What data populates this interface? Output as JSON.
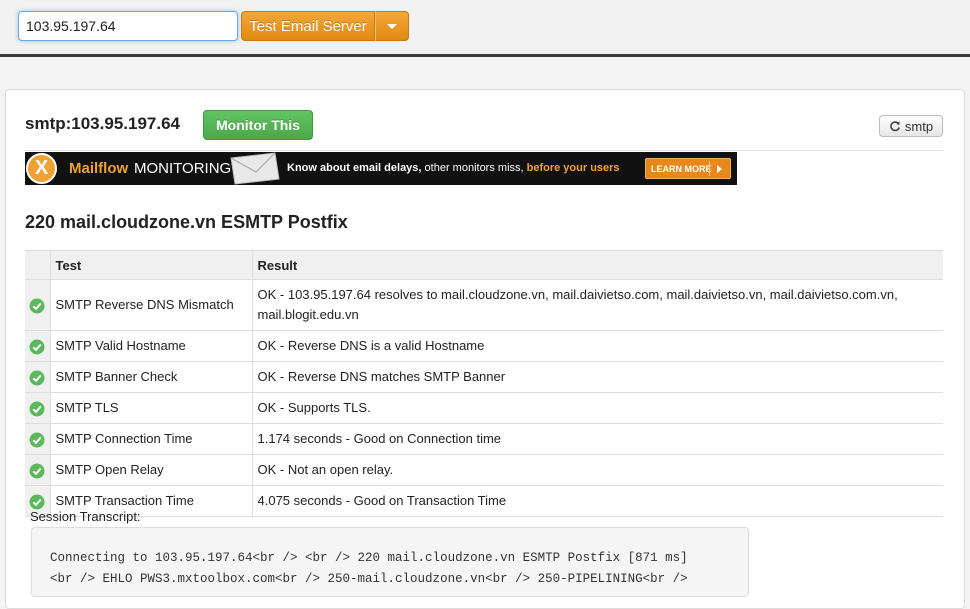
{
  "search": {
    "value": "103.95.197.64"
  },
  "toolbar": {
    "test_button_label": "Test Email Server"
  },
  "header": {
    "title": "smtp:103.95.197.64",
    "monitor_button_label": "Monitor This",
    "refresh_button_label": "smtp"
  },
  "banner": {
    "logo_letter": "X",
    "brand": "Mailflow",
    "monitoring": "MONITORING",
    "know_bold": "Know about email delays,",
    "know_normal": " other monitors miss, ",
    "know_orange": "before your users",
    "learn_more": "LEARN MORE"
  },
  "smtp_banner": "220 mail.cloudzone.vn ESMTP Postfix",
  "table": {
    "headers": {
      "test": "Test",
      "result": "Result"
    },
    "rows": [
      {
        "test": "SMTP Reverse DNS Mismatch",
        "result": "OK - 103.95.197.64 resolves to mail.cloudzone.vn, mail.daivietso.com, mail.daivietso.vn, mail.daivietso.com.vn, mail.blogit.edu.vn",
        "status": "ok"
      },
      {
        "test": "SMTP Valid Hostname",
        "result": "OK - Reverse DNS is a valid Hostname",
        "status": "ok"
      },
      {
        "test": "SMTP Banner Check",
        "result": "OK - Reverse DNS matches SMTP Banner",
        "status": "ok"
      },
      {
        "test": "SMTP TLS",
        "result": "OK - Supports TLS.",
        "status": "ok"
      },
      {
        "test": "SMTP Connection Time",
        "result": "1.174 seconds - Good on Connection time",
        "status": "ok"
      },
      {
        "test": "SMTP Open Relay",
        "result": "OK - Not an open relay.",
        "status": "ok"
      },
      {
        "test": "SMTP Transaction Time",
        "result": "4.075 seconds - Good on Transaction Time",
        "status": "ok"
      }
    ]
  },
  "session": {
    "label": "Session Transcript:",
    "text": "Connecting to 103.95.197.64<br /> <br /> 220 mail.cloudzone.vn ESMTP Postfix [871 ms]\n<br /> EHLO PWS3.mxtoolbox.com<br /> 250-mail.cloudzone.vn<br /> 250-PIPELINING<br />"
  },
  "colors": {
    "accent_orange": "#e8911f",
    "success_green": "#4cae4c",
    "ok_icon": "#5cb85c"
  }
}
